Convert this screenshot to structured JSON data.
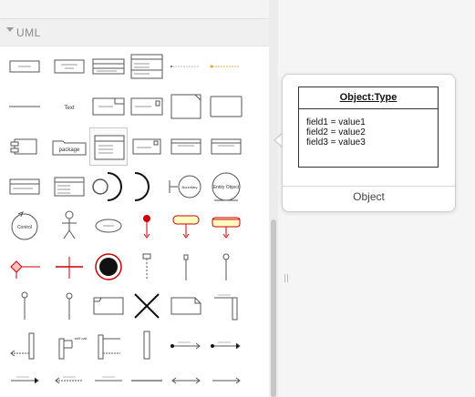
{
  "sidebar": {
    "section_title": "UML",
    "shapes": [
      "Object",
      "Object (attribute)",
      "Class",
      "Class (detailed)",
      "Inner attribute",
      "Inner method",
      "Separator line",
      "Text",
      "Frame",
      "Component",
      "Note",
      "Item",
      "Module",
      "Package",
      "Package (selected)",
      "Interface",
      "Component box",
      "Component small",
      "Class dependencies",
      "Provided interface",
      "Required interface",
      "Lollipop",
      "Entity",
      "Body object",
      "Control object",
      "Actor",
      "Use case",
      "Start state",
      "Activity",
      "Decision state",
      "Branch",
      "Fork",
      "End state",
      "Activation",
      "Lifeline",
      "Lifeline 2",
      "Lifeline pin",
      "Lifeline 3",
      "Frame 2",
      "Destroy",
      "Note 2",
      "Return",
      "Return message",
      "Message",
      "Callback",
      "Bar",
      "Dispatch",
      "Association",
      "Message arrow",
      "Reply",
      "Line",
      "Solid line",
      "Arrow",
      "Directed arrow"
    ]
  },
  "tooltip": {
    "object_title": "Object:Type",
    "fields": [
      "field1 = value1",
      "field2 = value2",
      "field3 = value3"
    ],
    "caption": "Object"
  },
  "scroll": {
    "position_fraction": 0.55
  }
}
